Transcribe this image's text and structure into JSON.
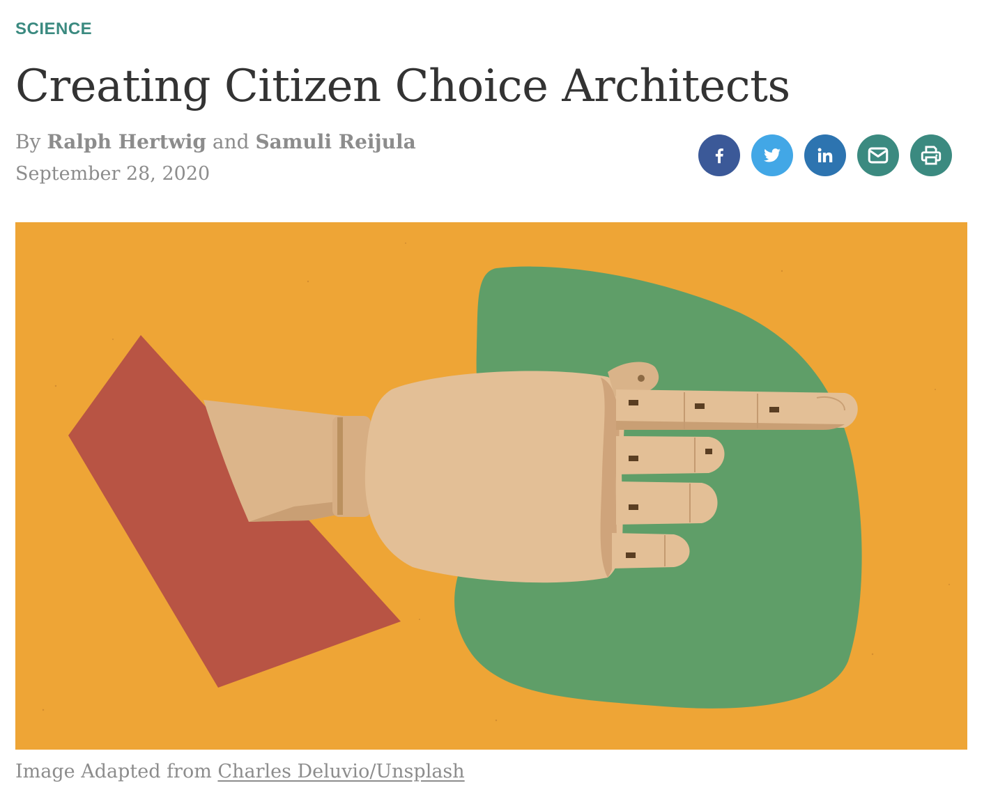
{
  "article": {
    "category": "SCIENCE",
    "title": "Creating Citizen Choice Architects",
    "byline": {
      "prefix": "By",
      "author_1": "Ralph Hertwig",
      "conjunction": "and",
      "author_2": "Samuli Reijula"
    },
    "date": "September 28, 2020"
  },
  "share": {
    "buttons": [
      {
        "icon": "facebook-icon",
        "color": "#3b5998"
      },
      {
        "icon": "twitter-icon",
        "color": "#42a7e6"
      },
      {
        "icon": "linkedin-icon",
        "color": "#2d74b0"
      },
      {
        "icon": "email-icon",
        "color": "#3b8a80"
      },
      {
        "icon": "print-icon",
        "color": "#3b8a80"
      }
    ]
  },
  "hero_image": {
    "colors": {
      "background": "#eea536",
      "blob": "#5f9e68",
      "shape": "#b85444",
      "wood": "#e3bf96"
    }
  },
  "caption": {
    "prefix": "Image Adapted from",
    "credit": "Charles Deluvio/Unsplash"
  }
}
